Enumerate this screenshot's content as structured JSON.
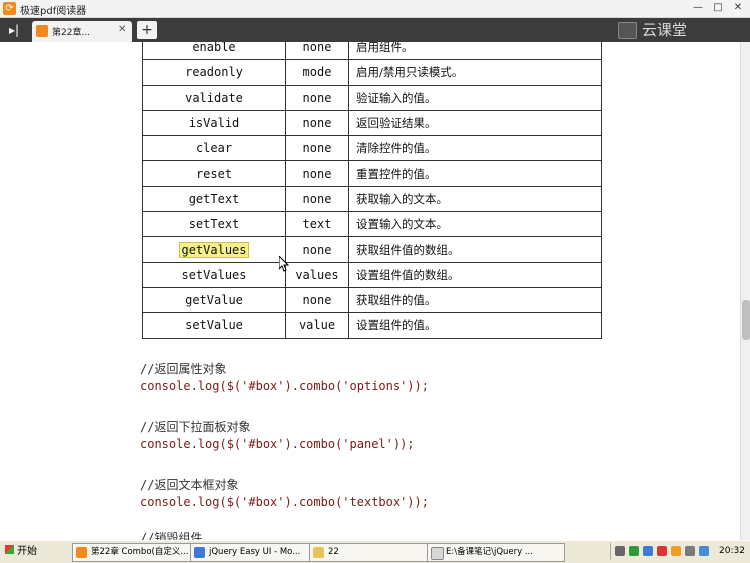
{
  "window": {
    "title": "极速pdf阅读器",
    "min": "—",
    "max": "□",
    "close": "✕"
  },
  "tabs": {
    "sidebar_toggle": "▸|",
    "active_label": "第22章...",
    "close": "✕",
    "new_tab": "+"
  },
  "brand": {
    "name": "云课堂"
  },
  "table": {
    "rows": [
      {
        "method": "enable",
        "param": "none",
        "desc": "启用组件。"
      },
      {
        "method": "readonly",
        "param": "mode",
        "desc": "启用/禁用只读模式。"
      },
      {
        "method": "validate",
        "param": "none",
        "desc": "验证输入的值。"
      },
      {
        "method": "isValid",
        "param": "none",
        "desc": "返回验证结果。"
      },
      {
        "method": "clear",
        "param": "none",
        "desc": "清除控件的值。"
      },
      {
        "method": "reset",
        "param": "none",
        "desc": "重置控件的值。"
      },
      {
        "method": "getText",
        "param": "none",
        "desc": "获取输入的文本。"
      },
      {
        "method": "setText",
        "param": "text",
        "desc": "设置输入的文本。"
      },
      {
        "method": "getValues",
        "param": "none",
        "desc": "获取组件值的数组。"
      },
      {
        "method": "setValues",
        "param": "values",
        "desc": "设置组件值的数组。"
      },
      {
        "method": "getValue",
        "param": "none",
        "desc": "获取组件的值。"
      },
      {
        "method": "setValue",
        "param": "value",
        "desc": "设置组件的值。"
      }
    ]
  },
  "code": {
    "c1": "//返回属性对象",
    "l1": "console.log($('#box').combo('options'));",
    "c2": "//返回下拉面板对象",
    "l2": "console.log($('#box').combo('panel'));",
    "c3": "//返回文本框对象",
    "l3": "console.log($('#box').combo('textbox'));",
    "c4": "//销毁组件"
  },
  "taskbar": {
    "start": "开始",
    "items": [
      "第22章 Combo(自定义...",
      "jQuery Easy UI - Mo...",
      "22",
      "E:\\备课笔记\\jQuery ..."
    ],
    "clock": "20:32"
  },
  "colors": {
    "accent": "#f08a1c",
    "highlight": "#f5f08a",
    "code": "#7a1a1a"
  }
}
